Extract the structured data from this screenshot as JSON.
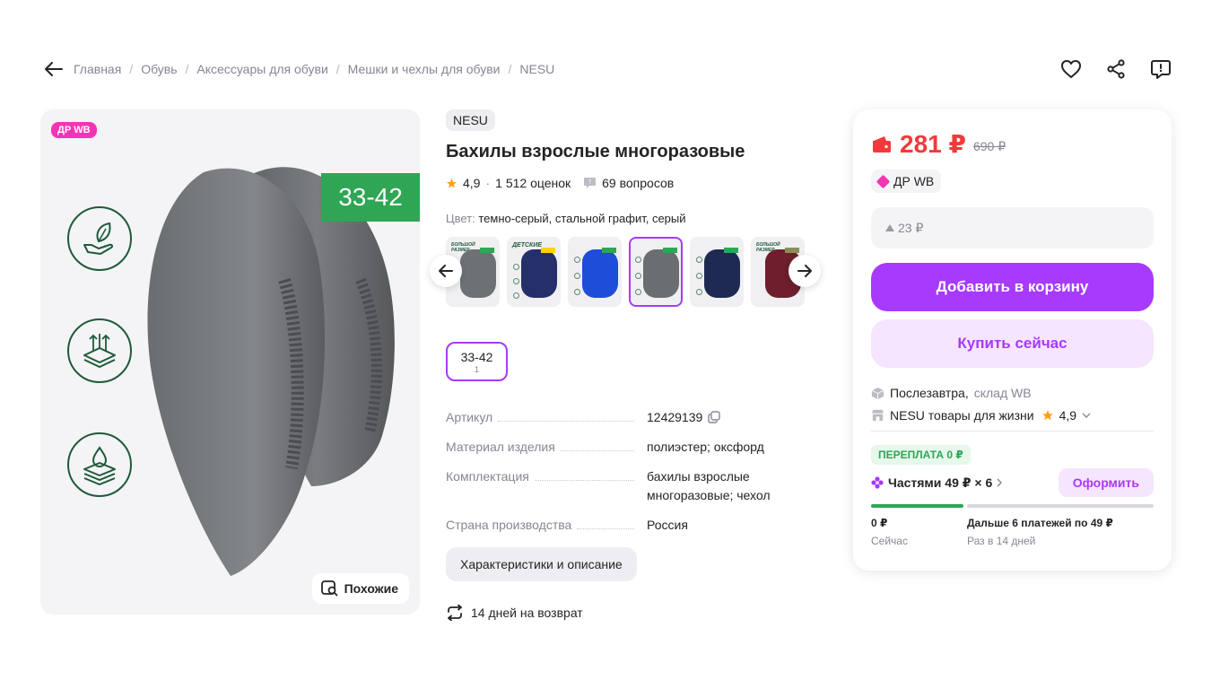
{
  "breadcrumbs": [
    "Главная",
    "Обувь",
    "Аксессуары для обуви",
    "Мешки и чехлы для обуви",
    "NESU"
  ],
  "gallery": {
    "badge": "ДР WB",
    "size_tag": "33-42",
    "similar_label": "Похожие"
  },
  "product": {
    "brand": "NESU",
    "title": "Бахилы взрослые многоразовые",
    "rating": "4,9",
    "reviews": "1 512 оценок",
    "questions": "69 вопросов",
    "color_label": "Цвет:",
    "color_value": "темно-серый, стальной графит, серый",
    "size": "33-42",
    "size_count": "1",
    "thumb_label_kids": "ДЕТСКИЕ",
    "thumb_label_big": "БОЛЬШОЙ РАЗМЕР"
  },
  "specs": [
    {
      "key": "Артикул",
      "value": "12429139"
    },
    {
      "key": "Материал изделия",
      "value": "полиэстер; оксфорд"
    },
    {
      "key": "Комплектация",
      "value": "бахилы взрослые многоразовые; чехол"
    },
    {
      "key": "Страна производства",
      "value": "Россия"
    }
  ],
  "chars_button": "Характеристики и описание",
  "return_text": "14 дней на возврат",
  "card": {
    "price": "281 ₽",
    "old_price": "690 ₽",
    "dr_label": "ДР WB",
    "wallet_discount": "23 ₽",
    "add_to_cart": "Добавить в корзину",
    "buy_now": "Купить сейчас",
    "delivery": "Послезавтра,",
    "warehouse": "склад WB",
    "seller": "NESU товары для жизни",
    "seller_rating": "4,9",
    "overpay": "ПЕРЕПЛАТА 0 ₽",
    "parts": "Частями 49 ₽ × 6",
    "form_button": "Оформить",
    "now_amount": "0 ₽",
    "now_label": "Сейчас",
    "next_amount": "Дальше 6 платежей по 49 ₽",
    "next_label": "Раз в 14 дней"
  },
  "colors": {
    "accent": "#a73afd",
    "price": "#f23a3a",
    "green": "#2ea653",
    "pink": "#f135b6"
  }
}
